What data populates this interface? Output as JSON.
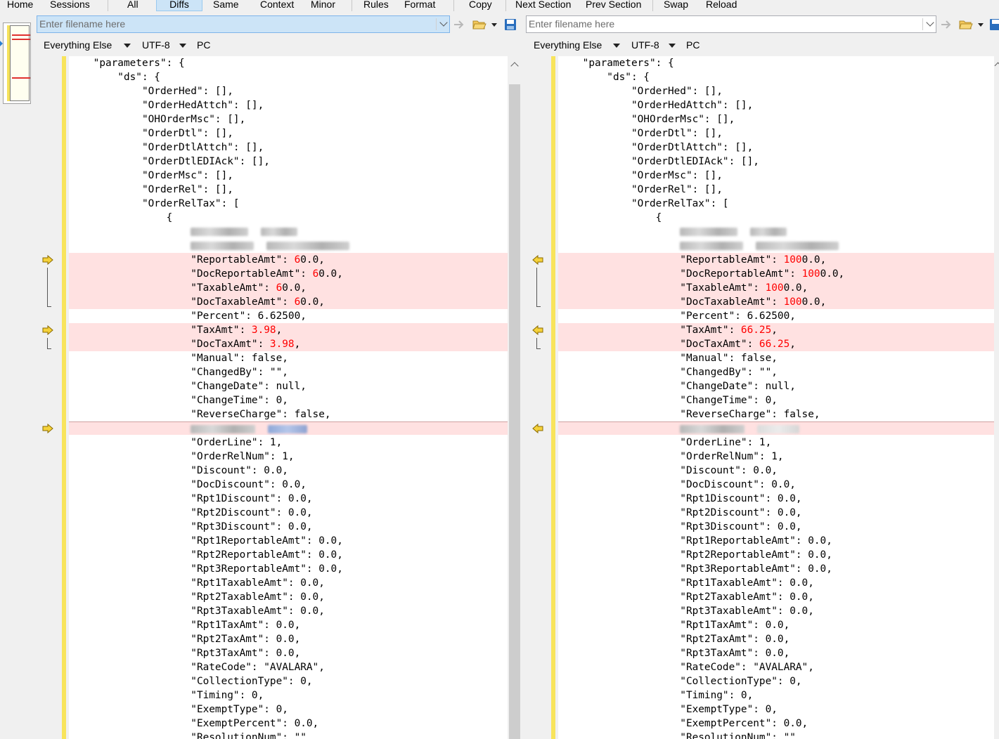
{
  "toolbar": {
    "home": "Home",
    "sessions": "Sessions",
    "all": "All",
    "diffs": "Diffs",
    "same": "Same",
    "context": "Context",
    "minor": "Minor",
    "rules": "Rules",
    "format": "Format",
    "copy": "Copy",
    "next_section": "Next Section",
    "prev_section": "Prev Section",
    "swap": "Swap",
    "reload": "Reload"
  },
  "left": {
    "filename_placeholder": "Enter filename here",
    "format": "Everything Else",
    "encoding": "UTF-8",
    "line_endings": "PC"
  },
  "right": {
    "filename_placeholder": "Enter filename here",
    "format": "Everything Else",
    "encoding": "UTF-8",
    "line_endings": "PC"
  },
  "colors": {
    "diff_bg": "#ffe1e1",
    "diff_text": "#ff0000",
    "change_bar": "#f8e45c"
  },
  "lines": {
    "l0": "    \"parameters\": {",
    "l1": "        \"ds\": {",
    "l2": "            \"OrderHed\": [],",
    "l3": "            \"OrderHedAttch\": [],",
    "l4": "            \"OHOrderMsc\": [],",
    "l5": "            \"OrderDtl\": [],",
    "l6": "            \"OrderDtlAttch\": [],",
    "l7": "            \"OrderDtlEDIAck\": [],",
    "l8": "            \"OrderMsc\": [],",
    "l9": "            \"OrderRel\": [],",
    "l10": "            \"OrderRelTax\": [",
    "l11": "                {",
    "ind": "                    ",
    "k_reportable": "\"ReportableAmt\": ",
    "k_docreportable": "\"DocReportableAmt\": ",
    "k_taxable": "\"TaxableAmt\": ",
    "k_doctaxable": "\"DocTaxableAmt\": ",
    "l_percent": "                    \"Percent\": 6.62500,",
    "k_taxamt": "\"TaxAmt\": ",
    "k_doctaxamt": "\"DocTaxAmt\": ",
    "l_manual": "                    \"Manual\": false,",
    "l_changedby": "                    \"ChangedBy\": \"\",",
    "l_changedate": "                    \"ChangeDate\": null,",
    "l_changetime": "                    \"ChangeTime\": 0,",
    "l_reverse": "                    \"ReverseCharge\": false,",
    "l_orderline": "                    \"OrderLine\": 1,",
    "l_orderrelnum": "                    \"OrderRelNum\": 1,",
    "l_discount": "                    \"Discount\": 0.0,",
    "l_docdiscount": "                    \"DocDiscount\": 0.0,",
    "l_rpt1disc": "                    \"Rpt1Discount\": 0.0,",
    "l_rpt2disc": "                    \"Rpt2Discount\": 0.0,",
    "l_rpt3disc": "                    \"Rpt3Discount\": 0.0,",
    "l_rpt1rep": "                    \"Rpt1ReportableAmt\": 0.0,",
    "l_rpt2rep": "                    \"Rpt2ReportableAmt\": 0.0,",
    "l_rpt3rep": "                    \"Rpt3ReportableAmt\": 0.0,",
    "l_rpt1tax": "                    \"Rpt1TaxableAmt\": 0.0,",
    "l_rpt2tax": "                    \"Rpt2TaxableAmt\": 0.0,",
    "l_rpt3tax": "                    \"Rpt3TaxableAmt\": 0.0,",
    "l_rpt1taxamt": "                    \"Rpt1TaxAmt\": 0.0,",
    "l_rpt2taxamt": "                    \"Rpt2TaxAmt\": 0.0,",
    "l_rpt3taxamt": "                    \"Rpt3TaxAmt\": 0.0,",
    "l_ratecode": "                    \"RateCode\": \"AVALARA\",",
    "l_collection": "                    \"CollectionType\": 0,",
    "l_timing": "                    \"Timing\": 0,",
    "l_exempttype": "                    \"ExemptType\": 0,",
    "l_exemptpct": "                    \"ExemptPercent\": 0.0,",
    "l_resolution": "                    \"ResolutionNum\": \"\""
  },
  "left_values": {
    "rep_hl": "6",
    "rep_rest": "0.0,",
    "tax_hl": "3.98",
    "comma": ","
  },
  "right_values": {
    "rep_hl": "100",
    "rep_rest": "0.0,",
    "tax_hl": "66.25",
    "comma": ","
  }
}
